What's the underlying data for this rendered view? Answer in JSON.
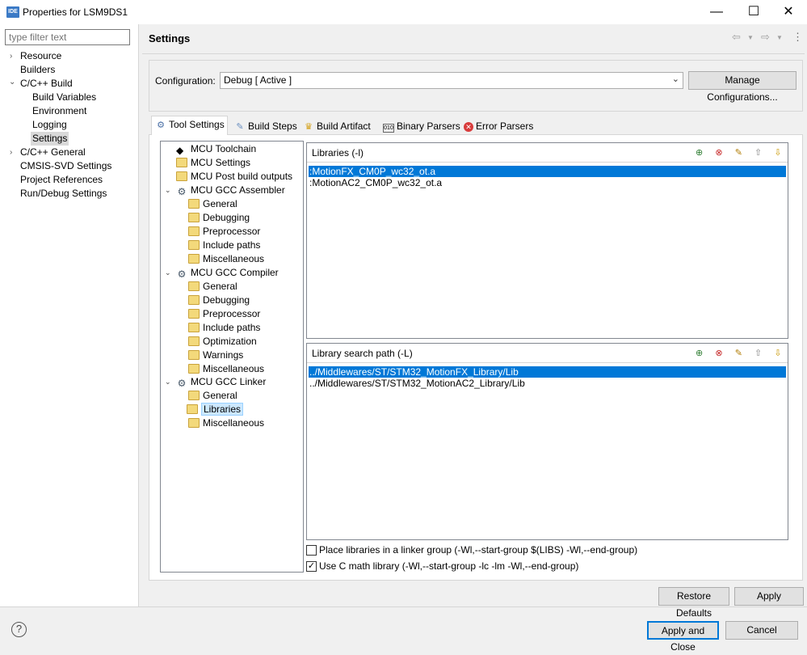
{
  "window": {
    "title": "Properties for LSM9DS1",
    "app_icon_text": "IDE"
  },
  "controls": {
    "minimize": "—",
    "maximize": "☐",
    "close": "✕"
  },
  "filter": {
    "placeholder": "type filter text"
  },
  "nav": [
    {
      "label": "Resource",
      "expander": "›"
    },
    {
      "label": "Builders"
    },
    {
      "label": "C/C++ Build",
      "expander": "⌄"
    },
    {
      "label": "Build Variables"
    },
    {
      "label": "Environment"
    },
    {
      "label": "Logging"
    },
    {
      "label": "Settings",
      "selected": true
    },
    {
      "label": "C/C++ General",
      "expander": "›"
    },
    {
      "label": "CMSIS-SVD Settings"
    },
    {
      "label": "Project References"
    },
    {
      "label": "Run/Debug Settings"
    }
  ],
  "header": {
    "title": "Settings",
    "back_icon": "⇦",
    "forward_icon": "⇨",
    "menu_icon": "⋮"
  },
  "configuration": {
    "label": "Configuration:",
    "value": "Debug  [ Active ]",
    "manage_button": "Manage Configurations..."
  },
  "tabs": [
    {
      "label": "Tool Settings",
      "icon": "tool-settings-icon",
      "active": true
    },
    {
      "label": "Build Steps",
      "icon": "build-steps-icon"
    },
    {
      "label": "Build Artifact",
      "icon": "build-artifact-icon"
    },
    {
      "label": "Binary Parsers",
      "icon": "binary-parsers-icon"
    },
    {
      "label": "Error Parsers",
      "icon": "error-parsers-icon"
    }
  ],
  "tree": [
    {
      "label": "MCU Toolchain"
    },
    {
      "label": "MCU Settings"
    },
    {
      "label": "MCU Post build outputs"
    },
    {
      "label": "MCU GCC Assembler"
    },
    {
      "label": "General"
    },
    {
      "label": "Debugging"
    },
    {
      "label": "Preprocessor"
    },
    {
      "label": "Include paths"
    },
    {
      "label": "Miscellaneous"
    },
    {
      "label": "MCU GCC Compiler"
    },
    {
      "label": "General"
    },
    {
      "label": "Debugging"
    },
    {
      "label": "Preprocessor"
    },
    {
      "label": "Include paths"
    },
    {
      "label": "Optimization"
    },
    {
      "label": "Warnings"
    },
    {
      "label": "Miscellaneous"
    },
    {
      "label": "MCU GCC Linker"
    },
    {
      "label": "General"
    },
    {
      "label": "Libraries",
      "selected": true
    },
    {
      "label": "Miscellaneous"
    }
  ],
  "libraries": {
    "title": "Libraries (-l)",
    "items": [
      ":MotionFX_CM0P_wc32_ot.a",
      ":MotionAC2_CM0P_wc32_ot.a"
    ]
  },
  "library_paths": {
    "title": "Library search path (-L)",
    "items": [
      "../Middlewares/ST/STM32_MotionFX_Library/Lib",
      "../Middlewares/ST/STM32_MotionAC2_Library/Lib"
    ]
  },
  "options": {
    "linker_group": {
      "label": "Place libraries in a linker group (-Wl,--start-group $(LIBS) -Wl,--end-group)",
      "checked": false
    },
    "c_math": {
      "label": "Use C math library (-Wl,--start-group -lc -lm -Wl,--end-group)",
      "checked": true
    }
  },
  "buttons": {
    "restore_defaults": "Restore Defaults",
    "apply": "Apply",
    "apply_and_close": "Apply and Close",
    "cancel": "Cancel",
    "help": "?"
  },
  "colors": {
    "selection": "#0078d7",
    "tree_selection": "#cce8ff",
    "folder": "#f3d97b"
  }
}
